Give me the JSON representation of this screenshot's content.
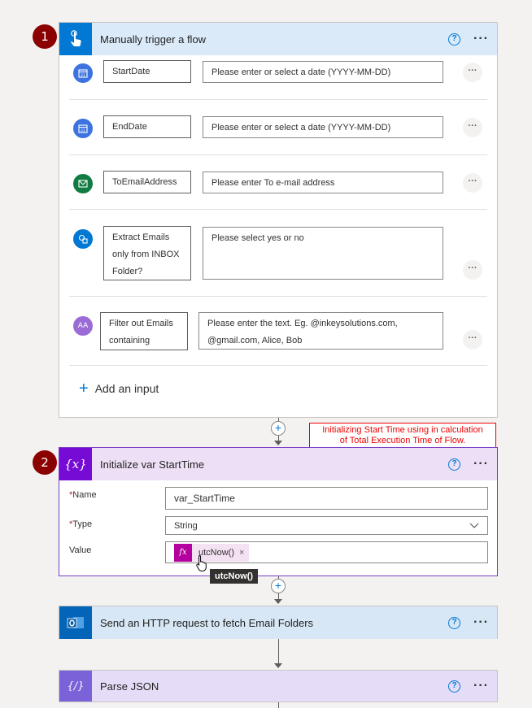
{
  "trigger": {
    "step_number": "1",
    "title": "Manually trigger a flow",
    "help_label": "?",
    "more_label": "···",
    "params": [
      {
        "label": "StartDate",
        "placeholder": "Please enter or select a date (YYYY-MM-DD)",
        "icon": "calendar-icon"
      },
      {
        "label": "EndDate",
        "placeholder": "Please enter or select a date (YYYY-MM-DD)",
        "icon": "calendar-icon"
      },
      {
        "label": "ToEmailAddress",
        "placeholder": "Please enter To e-mail address",
        "icon": "email-icon"
      },
      {
        "label_lines": [
          "Extract Emails",
          "only from INBOX",
          "Folder?"
        ],
        "placeholder": "Please select yes or no",
        "icon": "yesno-icon"
      },
      {
        "label_lines": [
          "Filter out Emails",
          "containing"
        ],
        "placeholder_lines": [
          "Please enter the text. Eg. @inkeysolutions.com,",
          "@gmail.com, Alice, Bob"
        ],
        "icon": "text-icon"
      }
    ],
    "row_more_label": "···",
    "add_input_label": "Add an input"
  },
  "annotation": {
    "lines": [
      "Initializing Start Time using in calculation",
      "of Total Execution Time of Flow."
    ]
  },
  "init_var": {
    "step_number": "2",
    "title": "Initialize var StartTime",
    "icon_text": "{x}",
    "help_label": "?",
    "more_label": "···",
    "name_label": "Name",
    "name_value": "var_StartTime",
    "type_label": "Type",
    "type_value": "String",
    "value_label": "Value",
    "expression_token": "utcNow()",
    "fx_label": "fx",
    "token_remove": "×",
    "required_marker": "*",
    "tooltip": "utcNow()"
  },
  "http_action": {
    "title": "Send an HTTP request to fetch Email Folders",
    "help_label": "?",
    "more_label": "···"
  },
  "parse_json": {
    "title": "Parse JSON",
    "icon_text": "{/}",
    "help_label": "?",
    "more_label": "···"
  },
  "connector_plus": "+",
  "colors": {
    "trigger_header": "#dbeaf9",
    "trigger_icon": "#0078d4",
    "variable_header": "#ede0f6",
    "variable_icon": "#770bd6",
    "variable_border": "#7a3ec5",
    "http_header": "#d7e7f5",
    "http_icon": "#0364b8",
    "parse_header": "#e5ddf7",
    "parse_icon": "#7b62d8",
    "fx_token": "#b4009e"
  }
}
